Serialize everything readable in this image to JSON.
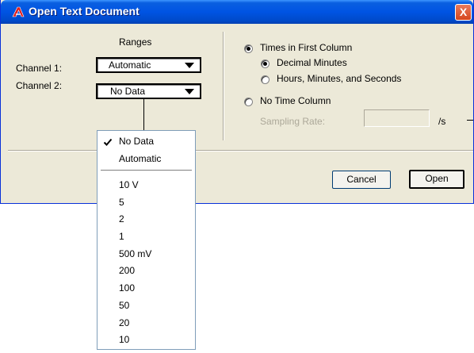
{
  "window": {
    "title": "Open Text Document",
    "close_glyph": "X",
    "colors": {
      "titlebar": "#0054e3",
      "face": "#ece9d8",
      "close": "#d6461d"
    }
  },
  "ranges": {
    "header": "Ranges",
    "channel1_label": "Channel 1:",
    "channel1_value": "Automatic",
    "channel2_label": "Channel 2:",
    "channel2_value": "No Data"
  },
  "time_options": {
    "times_in_first_column": "Times in First Column",
    "decimal_minutes": "Decimal Minutes",
    "hours_minutes_seconds": "Hours, Minutes, and Seconds",
    "no_time_column": "No Time Column",
    "sampling_rate_label": "Sampling Rate:",
    "sampling_rate_unit": "/s",
    "selected_primary": "Times in First Column",
    "selected_format": "Decimal Minutes"
  },
  "buttons": {
    "cancel": "Cancel",
    "open": "Open"
  },
  "dropdown": {
    "selected": "No Data",
    "items": [
      "No Data",
      "Automatic"
    ],
    "ranges": [
      "10 V",
      "5",
      "2",
      "1",
      "500 mV",
      "200",
      "100",
      "50",
      "20",
      "10"
    ]
  }
}
